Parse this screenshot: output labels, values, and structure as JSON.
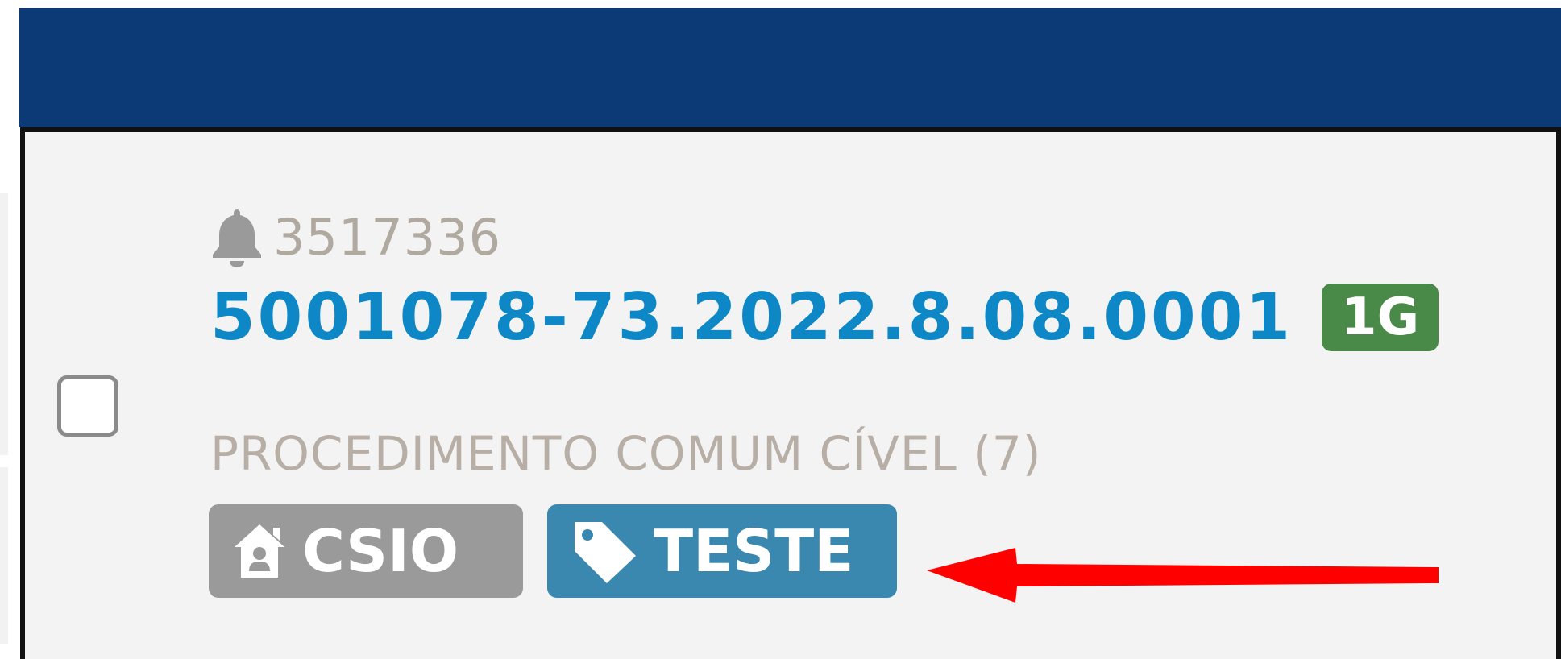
{
  "header": {
    "color": "#0b3a76"
  },
  "item": {
    "notification_icon": "bell-icon",
    "notification_id": "3517336",
    "process_number": "5001078-73.2022.8.08.0001",
    "instance_badge": "1G",
    "class_name": "PROCEDIMENTO COMUM CÍVEL (7)",
    "tags": [
      {
        "icon": "house-user-icon",
        "label": "CSIO",
        "color": "#9a9a9a"
      },
      {
        "icon": "tag-icon",
        "label": "TESTE",
        "color": "#3a88b0"
      }
    ]
  },
  "annotation": {
    "arrow_color": "#ff0000",
    "arrow_target": "tag-teste"
  }
}
